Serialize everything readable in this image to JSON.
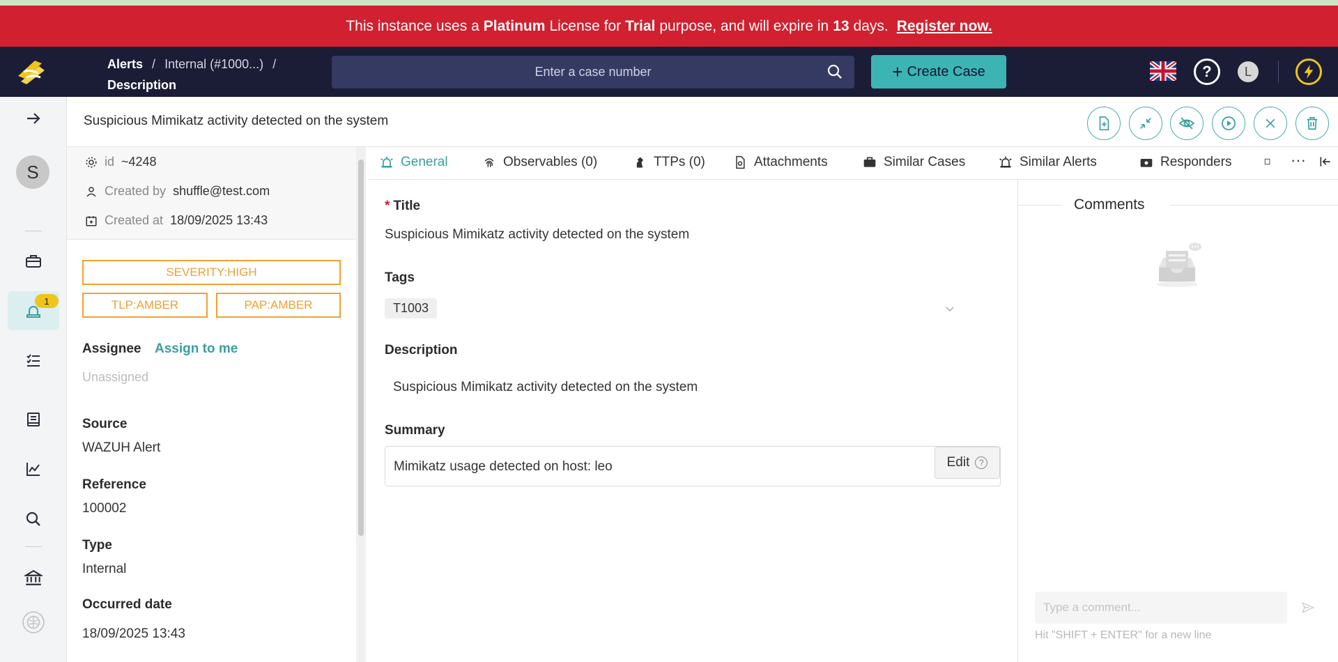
{
  "banner": {
    "prefix": "This instance uses a",
    "license": "Platinum",
    "middle": "License for",
    "purpose": "Trial",
    "suffix": "purpose, and will expire in",
    "days": "13",
    "days_suffix": "days.",
    "register": "Register now."
  },
  "header": {
    "breadcrumb": {
      "item1": "Alerts",
      "item2": "Internal (#1000...)",
      "item3": "Description",
      "separator": "/"
    },
    "search_placeholder": "Enter a case number",
    "create_case": "Create Case",
    "user_initial": "L"
  },
  "sidebar": {
    "user_initial": "S",
    "alerts_badge": "1"
  },
  "alert": {
    "title": "Suspicious Mimikatz activity detected on the system",
    "id_label": "id",
    "id": "~4248",
    "created_by_label": "Created by",
    "created_by": "shuffle@test.com",
    "created_at_label": "Created at",
    "created_at": "18/09/2025 13:43",
    "severity": "SEVERITY:HIGH",
    "tlp": "TLP:AMBER",
    "pap": "PAP:AMBER",
    "assignee_label": "Assignee",
    "assign_to_me": "Assign to me",
    "assignee_value": "Unassigned",
    "source_label": "Source",
    "source": "WAZUH Alert",
    "reference_label": "Reference",
    "reference": "100002",
    "type_label": "Type",
    "type": "Internal",
    "occurred_label": "Occurred date",
    "occurred": "18/09/2025 13:43"
  },
  "tabs": [
    {
      "label": "General"
    },
    {
      "label": "Observables (0)"
    },
    {
      "label": "TTPs (0)"
    },
    {
      "label": "Attachments"
    },
    {
      "label": "Similar Cases"
    },
    {
      "label": "Similar Alerts"
    },
    {
      "label": "Responders"
    }
  ],
  "tabs_more": "···",
  "general": {
    "title_label": "Title",
    "title_value": "Suspicious Mimikatz activity detected on the system",
    "tags_label": "Tags",
    "tags": [
      "T1003"
    ],
    "description_label": "Description",
    "description_value": "Suspicious Mimikatz activity detected on the system",
    "summary_label": "Summary",
    "summary_value": "Mimikatz usage detected on host: leo",
    "edit_label": "Edit"
  },
  "comments": {
    "title": "Comments",
    "placeholder": "Type a comment...",
    "hint": "Hit \"SHIFT + ENTER\" for a new line"
  },
  "colors": {
    "banner_bg": "#d1202f",
    "header_bg": "#1a1d35",
    "accent": "#3cb4b4",
    "amber": "#f0a030"
  }
}
